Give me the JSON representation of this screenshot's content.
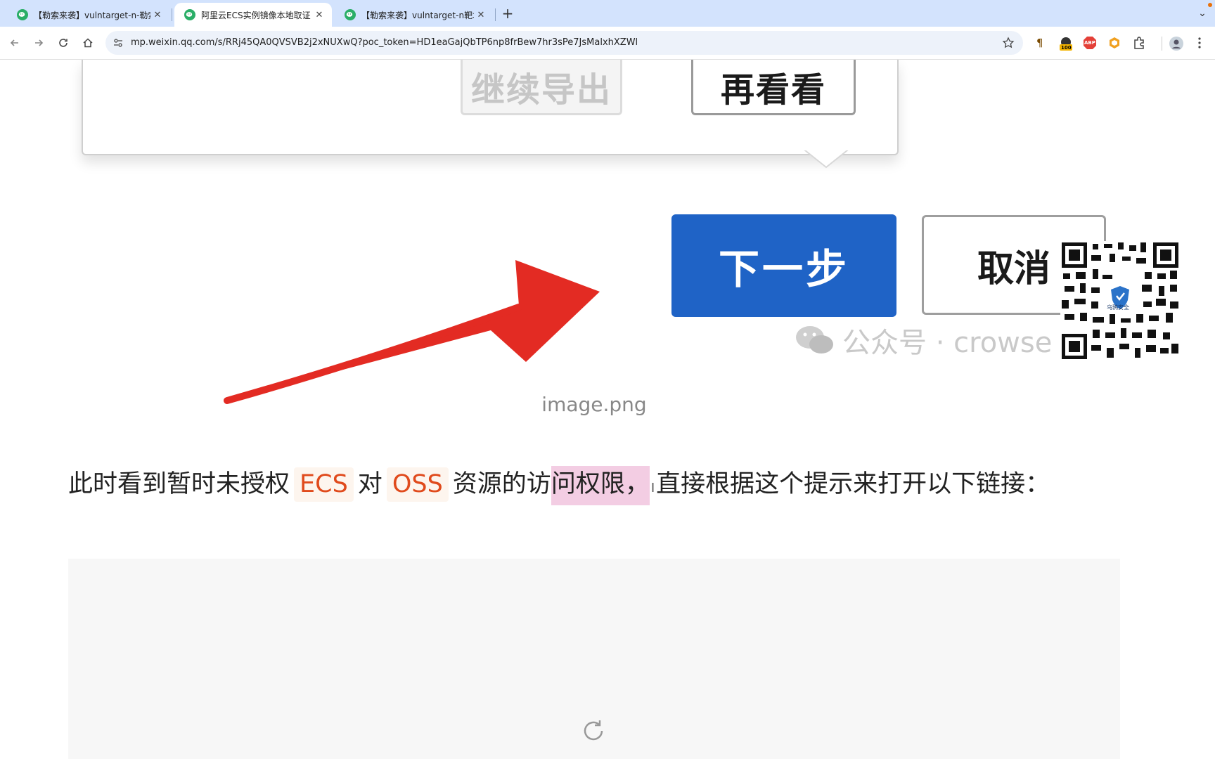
{
  "browser": {
    "tabs": [
      {
        "title": "【勒索来袭】vulntarget-n-勒索",
        "active": false
      },
      {
        "title": "阿里云ECS实例镜像本地取证",
        "active": true
      },
      {
        "title": "【勒索来袭】vulntarget-n靶场",
        "active": false
      }
    ],
    "url": "mp.weixin.qq.com/s/RRj45QA0QVSVB2j2xNUXwQ?poc_token=HD1eaGajQbTP6np8frBew7hr3sPe7JsMalxhXZWl",
    "extension_badges": {
      "counter": "100",
      "abp": "ABP"
    }
  },
  "screenshot_image": {
    "dialog_buttons": {
      "continue_export": "继续导出",
      "look_again": "再看看"
    },
    "next_button": "下一步",
    "cancel_button": "取消",
    "watermark": "公众号 · crowse",
    "qr_label": "乌鸦安全"
  },
  "caption": "image.png",
  "paragraph": {
    "text_1": "此时看到暂时未授权",
    "code_1": "ECS",
    "text_2": "对",
    "code_2": "OSS",
    "text_3": "资源的访",
    "highlight": "问权限，",
    "text_4": "直接根据这个提示来打开以下链接："
  },
  "colors": {
    "accent_blue": "#1f63c6",
    "arrow_red": "#e32b23",
    "code_text": "#e04a1c",
    "selection": "#f3cde3",
    "tabstrip": "#d3e3fd"
  }
}
